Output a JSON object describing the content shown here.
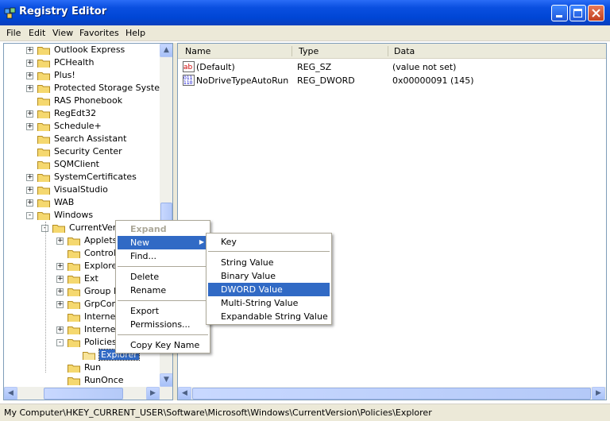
{
  "window": {
    "title": "Registry Editor"
  },
  "menubar": [
    "File",
    "Edit",
    "View",
    "Favorites",
    "Help"
  ],
  "tree": {
    "items": [
      {
        "label": "Outlook Express",
        "expander": "+"
      },
      {
        "label": "PCHealth",
        "expander": "+"
      },
      {
        "label": "Plus!",
        "expander": "+"
      },
      {
        "label": "Protected Storage System P",
        "expander": "+"
      },
      {
        "label": "RAS Phonebook",
        "expander": ""
      },
      {
        "label": "RegEdt32",
        "expander": "+"
      },
      {
        "label": "Schedule+",
        "expander": "+"
      },
      {
        "label": "Search Assistant",
        "expander": ""
      },
      {
        "label": "Security Center",
        "expander": ""
      },
      {
        "label": "SQMClient",
        "expander": ""
      },
      {
        "label": "SystemCertificates",
        "expander": "+"
      },
      {
        "label": "VisualStudio",
        "expander": "+"
      },
      {
        "label": "WAB",
        "expander": "+"
      },
      {
        "label": "Windows",
        "expander": "-"
      },
      {
        "label": "CurrentVers",
        "expander": "-"
      },
      {
        "label": "Applets",
        "expander": "+"
      },
      {
        "label": "Controls",
        "expander": ""
      },
      {
        "label": "Explorer",
        "expander": "+"
      },
      {
        "label": "Ext",
        "expander": "+"
      },
      {
        "label": "Group Po",
        "expander": "+"
      },
      {
        "label": "GrpConv",
        "expander": "+"
      },
      {
        "label": "Interne",
        "expander": ""
      },
      {
        "label": "Interne",
        "expander": "+"
      },
      {
        "label": "Policies",
        "expander": "-"
      },
      {
        "label": "Explorer",
        "expander": ""
      },
      {
        "label": "Run",
        "expander": ""
      },
      {
        "label": "RunOnce",
        "expander": ""
      }
    ]
  },
  "list": {
    "columns": [
      "Name",
      "Type",
      "Data"
    ],
    "rows": [
      {
        "name": "(Default)",
        "type": "REG_SZ",
        "data": "(value not set)",
        "icon": "string-value-icon"
      },
      {
        "name": "NoDriveTypeAutoRun",
        "type": "REG_DWORD",
        "data": "0x00000091 (145)",
        "icon": "binary-value-icon"
      }
    ]
  },
  "context_menu": {
    "items": [
      "Expand",
      "New",
      "Find...",
      "Delete",
      "Rename",
      "Export",
      "Permissions...",
      "Copy Key Name"
    ]
  },
  "submenu": {
    "items": [
      "Key",
      "String Value",
      "Binary Value",
      "DWORD Value",
      "Multi-String Value",
      "Expandable String Value"
    ],
    "highlighted": "DWORD Value"
  },
  "status": "My Computer\\HKEY_CURRENT_USER\\Software\\Microsoft\\Windows\\CurrentVersion\\Policies\\Explorer",
  "colors": {
    "titlebar": "#0046d5",
    "selection": "#316ac5",
    "chrome": "#ece9d8"
  }
}
